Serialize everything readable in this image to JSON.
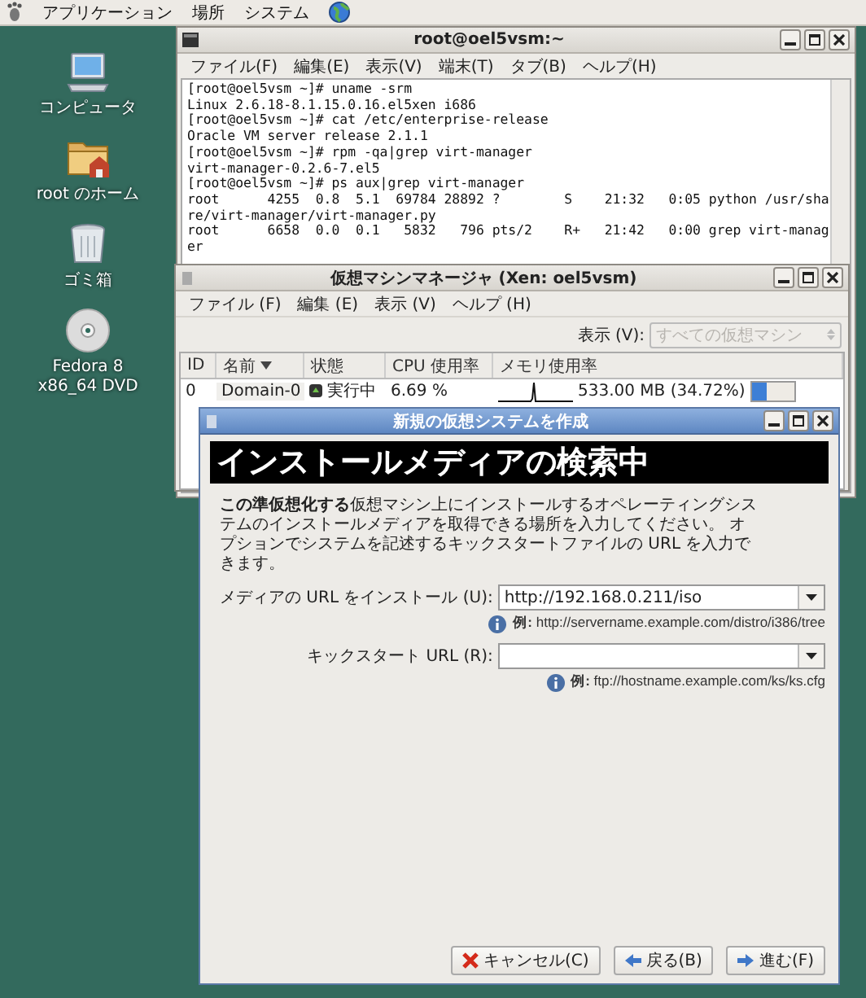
{
  "top_panel": {
    "menus": [
      "アプリケーション",
      "場所",
      "システム"
    ]
  },
  "desktop_icons": [
    {
      "kind": "computer",
      "label": "コンピュータ"
    },
    {
      "kind": "home",
      "label": "root のホーム"
    },
    {
      "kind": "trash",
      "label": "ゴミ箱"
    },
    {
      "kind": "disc",
      "label": "Fedora 8 x86_64 DVD"
    }
  ],
  "terminal": {
    "title": "root@oel5vsm:~",
    "menus": [
      "ファイル(F)",
      "編集(E)",
      "表示(V)",
      "端末(T)",
      "タブ(B)",
      "ヘルプ(H)"
    ],
    "lines": [
      "[root@oel5vsm ~]# uname -srm",
      "Linux 2.6.18-8.1.15.0.16.el5xen i686",
      "[root@oel5vsm ~]# cat /etc/enterprise-release",
      "Oracle VM server release 2.1.1",
      "[root@oel5vsm ~]# rpm -qa|grep virt-manager",
      "virt-manager-0.2.6-7.el5",
      "[root@oel5vsm ~]# ps aux|grep virt-manager",
      "root      4255  0.8  5.1  69784 28892 ?        S    21:32   0:05 python /usr/sha",
      "re/virt-manager/virt-manager.py",
      "root      6658  0.0  0.1   5832   796 pts/2    R+   21:42   0:00 grep virt-manag",
      "er"
    ]
  },
  "vm_manager": {
    "title": "仮想マシンマネージャ (Xen: oel5vsm)",
    "menus": [
      "ファイル (F)",
      "編集 (E)",
      "表示 (V)",
      "ヘルプ (H)"
    ],
    "view_label": "表示 (V):",
    "view_filter": {
      "value": "すべての仮想マシン",
      "disabled": true
    },
    "columns": [
      "ID",
      "名前",
      "状態",
      "CPU 使用率",
      "メモリ使用率"
    ],
    "rows": [
      {
        "id": "0",
        "name": "Domain-0",
        "status": "実行中",
        "cpu": "6.69 %",
        "memory": "533.00 MB (34.72%)",
        "level": 0.3472
      }
    ]
  },
  "dialog": {
    "title": "新規の仮想システムを作成",
    "heading": "インストールメディアの検索中",
    "description": "**この準仮想化する**仮想マシン上にインストールするオペレーティングシステムのインストールメディアを取得できる場所を入力してください。 オプションでシステムを記述するキックスタートファイルの URL を入力できます。",
    "fields": [
      {
        "label": "メディアの URL をインストール (U):",
        "value": "http://192.168.0.211/iso",
        "hint": "**例:** http://servername.example.com/distro/i386/tree"
      },
      {
        "label": "キックスタート URL (R):",
        "hint": "**例:** ftp://hostname.example.com/ks/ks.cfg"
      }
    ],
    "buttons": [
      {
        "kind": "cancel",
        "label": "キャンセル(C)"
      },
      {
        "kind": "back",
        "label": "戻る(B)"
      },
      {
        "kind": "forward",
        "label": "進む(F)"
      }
    ]
  }
}
